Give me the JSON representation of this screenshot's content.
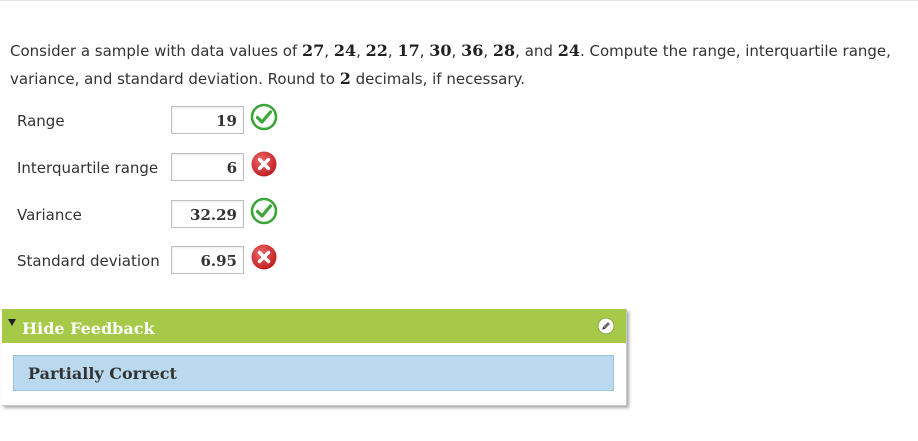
{
  "question": {
    "p1": "Consider a sample with data values of ",
    "values": [
      "27",
      "24",
      "22",
      "17",
      "30",
      "36",
      "28",
      "24"
    ],
    "and": "and",
    "p2": ". Compute the range, interquartile range, variance, and standard deviation. Round to ",
    "decimals": "2",
    "p3": " decimals, if necessary."
  },
  "answers": [
    {
      "label": "Range",
      "value": "19",
      "status": "correct-icon"
    },
    {
      "label": "Interquartile range",
      "value": "6",
      "status": "incorrect-icon"
    },
    {
      "label": "Variance",
      "value": "32.29",
      "status": "correct-icon"
    },
    {
      "label": "Standard deviation",
      "value": "6.95",
      "status": "incorrect-icon"
    }
  ],
  "feedback": {
    "toggle_label": "Hide Feedback",
    "status": "Partially Correct",
    "edit_icon": "pencil-icon"
  },
  "colors": {
    "header_green": "#a6c94a",
    "feedback_blue": "#bad9ee",
    "correct_green": "#3aa63a",
    "incorrect_red": "#d9292b"
  }
}
